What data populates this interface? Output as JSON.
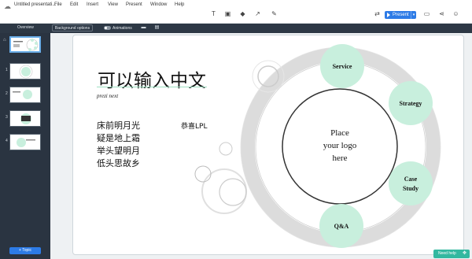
{
  "app": {
    "title": "Untitled presentati...",
    "menus": [
      "File",
      "Edit",
      "Insert",
      "View",
      "Present",
      "Window",
      "Help"
    ],
    "present_label": "Present"
  },
  "toolbar": {
    "overview": "Overview",
    "background_options": "Background options",
    "animations": "Animations"
  },
  "sidebar": {
    "thumbs": [
      {
        "num": "",
        "label": "Overview"
      },
      {
        "num": "1",
        "label": ""
      },
      {
        "num": "2",
        "label": ""
      },
      {
        "num": "3",
        "label": ""
      },
      {
        "num": "4",
        "label": ""
      }
    ],
    "add_topic": "+ Topic"
  },
  "slide": {
    "title": "可以输入中文",
    "subtitle": "prezi next",
    "poem": [
      "床前明月光",
      "疑是地上霜",
      "举头望明月",
      "低头思故乡"
    ],
    "author": "恭喜LPL",
    "logo_lines": [
      "Place",
      "your logo",
      "here"
    ],
    "topics": [
      "Service",
      "Strategy",
      "Case",
      "Study",
      "Q&A"
    ]
  },
  "help_label": "Need help",
  "colors": {
    "accent": "#2d7be6",
    "topic_fill": "#c8efdd",
    "sidebar": "#2a3441"
  }
}
